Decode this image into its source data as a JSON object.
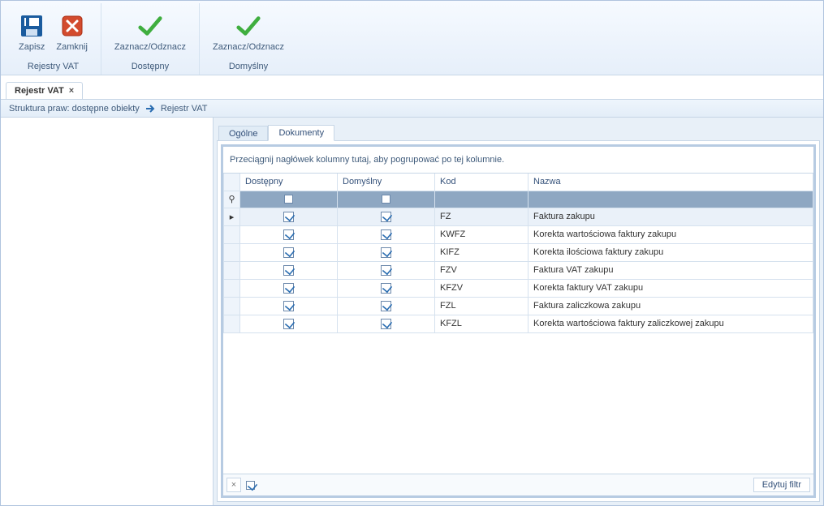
{
  "ribbon": {
    "group1": {
      "title": "Rejestry VAT",
      "save_label": "Zapisz",
      "close_label": "Zamknij"
    },
    "group2": {
      "title": "Dostępny",
      "toggle_label": "Zaznacz/Odznacz"
    },
    "group3": {
      "title": "Domyślny",
      "toggle_label": "Zaznacz/Odznacz"
    }
  },
  "doc_tab": {
    "title": "Rejestr VAT",
    "close_glyph": "×"
  },
  "breadcrumb": {
    "a": "Struktura praw: dostępne obiekty",
    "b": "Rejestr VAT"
  },
  "inner_tabs": {
    "ogolne": "Ogólne",
    "dokumenty": "Dokumenty"
  },
  "grid": {
    "group_hint": "Przeciągnij nagłówek kolumny tutaj, aby pogrupować po tej kolumnie.",
    "columns": {
      "dostepny": "Dostępny",
      "domyslny": "Domyślny",
      "kod": "Kod",
      "nazwa": "Nazwa"
    },
    "filter_key_glyph": "⚲",
    "row_indicator_glyph": "▸",
    "rows": [
      {
        "dostepny": true,
        "domyslny": true,
        "kod": "FZ",
        "nazwa": "Faktura zakupu"
      },
      {
        "dostepny": true,
        "domyslny": true,
        "kod": "KWFZ",
        "nazwa": "Korekta wartościowa faktury zakupu"
      },
      {
        "dostepny": true,
        "domyslny": true,
        "kod": "KIFZ",
        "nazwa": "Korekta ilościowa faktury zakupu"
      },
      {
        "dostepny": true,
        "domyslny": true,
        "kod": "FZV",
        "nazwa": "Faktura VAT zakupu"
      },
      {
        "dostepny": true,
        "domyslny": true,
        "kod": "KFZV",
        "nazwa": "Korekta faktury VAT zakupu"
      },
      {
        "dostepny": true,
        "domyslny": true,
        "kod": "FZL",
        "nazwa": "Faktura zaliczkowa zakupu"
      },
      {
        "dostepny": true,
        "domyslny": true,
        "kod": "KFZL",
        "nazwa": "Korekta wartościowa faktury zaliczkowej zakupu"
      }
    ],
    "footer": {
      "clear_glyph": "×",
      "checked": true,
      "edit_filter": "Edytuj filtr"
    }
  }
}
